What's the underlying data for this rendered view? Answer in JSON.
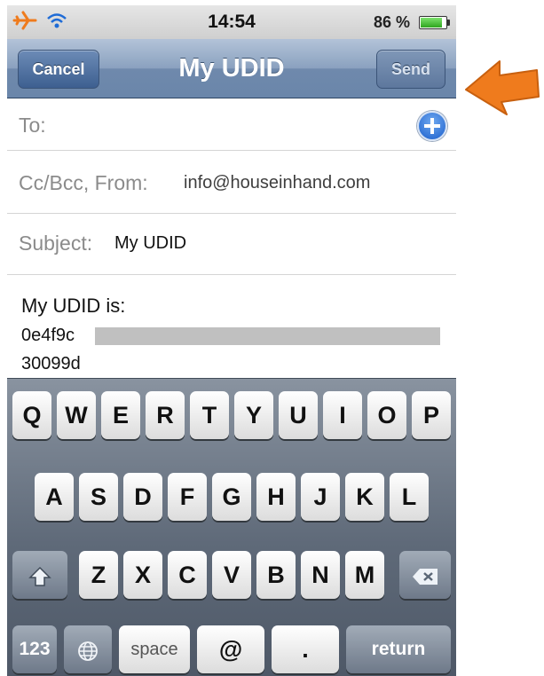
{
  "status_bar": {
    "time": "14:54",
    "battery_percent": "86 %",
    "battery_level": 0.86,
    "airplane_icon": "airplane-icon",
    "wifi_icon": "wifi-icon"
  },
  "nav": {
    "title": "My UDID",
    "cancel_label": "Cancel",
    "send_label": "Send"
  },
  "fields": {
    "to_label": "To:",
    "cc_label": "Cc/Bcc, From:",
    "from_value": "info@houseinhand.com",
    "subject_label": "Subject:",
    "subject_value": "My UDID"
  },
  "body": {
    "line1": "My UDID is:",
    "line2": "0e4f9c",
    "line3": "30099d"
  },
  "keyboard": {
    "row1": [
      "Q",
      "W",
      "E",
      "R",
      "T",
      "Y",
      "U",
      "I",
      "O",
      "P"
    ],
    "row2": [
      "A",
      "S",
      "D",
      "F",
      "G",
      "H",
      "J",
      "K",
      "L"
    ],
    "row3": [
      "Z",
      "X",
      "C",
      "V",
      "B",
      "N",
      "M"
    ],
    "numbers_label": "123",
    "space_label": "space",
    "at_label": "@",
    "dot_label": ".",
    "return_label": "return"
  },
  "annotation": {
    "arrow_color": "#ef7b1d",
    "arrow_icon": "arrow-left-icon"
  },
  "colors": {
    "nav_blue": "#6f89ac",
    "keyboard_bg": "#5f6a79"
  }
}
